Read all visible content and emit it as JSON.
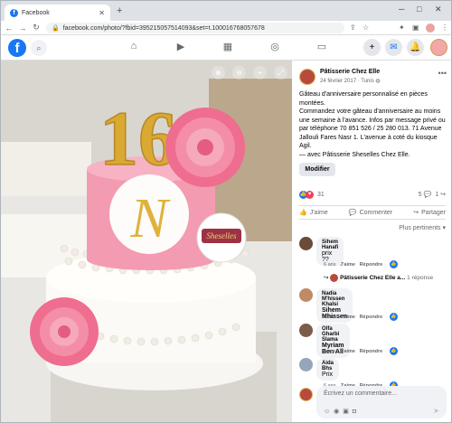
{
  "browser": {
    "tab_title": "Facebook",
    "url": "facebook.com/photo/?fbid=395215057514093&set=t.100016768057678",
    "new_tab": "+",
    "win_min": "─",
    "win_max": "□",
    "win_close": "✕"
  },
  "fb": {
    "logo": "f"
  },
  "photo": {
    "cake_letter": "N",
    "cake_number": "16",
    "logo_text": "Sheselles"
  },
  "post": {
    "page_name": "Pâtisserie Chez Elle",
    "date": "24 février 2017",
    "location": "Tunis",
    "desc_1": "Gâteau d'anniversaire personnalisé en pièces montées.",
    "desc_2": "Commandez votre gâteau d'anniversaire au moins une semaine à l'avance. Infos par message privé ou par téléphone 70 851 526 / 25 280 013. 71 Avenue Jallouli Fares Nasr 1. L'avenue à coté du kiosque Agil.",
    "desc_3": "— avec Pâtisserie Sheselles Chez Elle.",
    "modify_label": "Modifier",
    "reaction_count": "31",
    "comment_count": "5",
    "share_count": "1",
    "like_label": "J'aime",
    "comment_label": "Commenter",
    "share_label": "Partager",
    "filter_label": "Plus pertinents ▾"
  },
  "comments": [
    {
      "name": "Sihem Hanafi",
      "text": "prix ??",
      "time": "6 ans",
      "like": "J'aime",
      "reply": "Répondre",
      "reaction": "1"
    },
    {
      "name": "Nadia M'hissen Khalsi",
      "text": "Sihem Mhissen",
      "time": "6 ans",
      "like": "J'aime",
      "reply": "Répondre",
      "reaction": "1"
    },
    {
      "name": "Olfa Gharbi Slama",
      "text": "Myriam Ben Ali",
      "time": "6 ans",
      "like": "J'aime",
      "reply": "Répondre",
      "reaction": "1"
    },
    {
      "name": "Aida Bhs",
      "text": "Prix",
      "time": "6 ans",
      "like": "J'aime",
      "reply": "Répondre",
      "reaction": "1"
    }
  ],
  "reply_thread": {
    "author": "Pâtisserie Chez Elle a...",
    "count": "1 réponse"
  },
  "write": {
    "placeholder": "Écrivez un commentaire..."
  },
  "colors": {
    "fb_blue": "#1877f2",
    "like_blue": "#1877f2",
    "love_red": "#f33e58"
  }
}
